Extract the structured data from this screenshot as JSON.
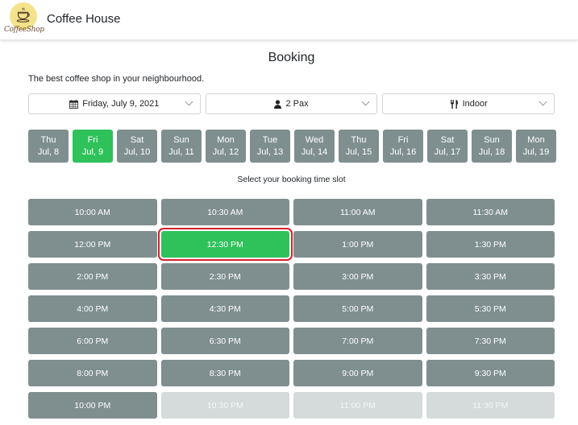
{
  "header": {
    "logo_text": "CoffeeShop",
    "brand": "Coffee House"
  },
  "page": {
    "title": "Booking",
    "tagline": "The best coffee shop in your neighbourhood.",
    "slot_hint": "Select your booking time slot"
  },
  "filters": {
    "date": {
      "icon": "calendar-icon",
      "value": "Friday, July 9, 2021"
    },
    "party": {
      "icon": "person-icon",
      "value": "2 Pax"
    },
    "seating": {
      "icon": "utensils-icon",
      "value": "Indoor"
    }
  },
  "dates": [
    {
      "day": "Thu",
      "date": "Jul, 8",
      "active": false
    },
    {
      "day": "Fri",
      "date": "Jul, 9",
      "active": true
    },
    {
      "day": "Sat",
      "date": "Jul, 10",
      "active": false
    },
    {
      "day": "Sun",
      "date": "Jul, 11",
      "active": false
    },
    {
      "day": "Mon",
      "date": "Jul, 12",
      "active": false
    },
    {
      "day": "Tue",
      "date": "Jul, 13",
      "active": false
    },
    {
      "day": "Wed",
      "date": "Jul, 14",
      "active": false
    },
    {
      "day": "Thu",
      "date": "Jul, 15",
      "active": false
    },
    {
      "day": "Fri",
      "date": "Jul, 16",
      "active": false
    },
    {
      "day": "Sat",
      "date": "Jul, 17",
      "active": false
    },
    {
      "day": "Sun",
      "date": "Jul, 18",
      "active": false
    },
    {
      "day": "Mon",
      "date": "Jul, 19",
      "active": false
    }
  ],
  "slots": [
    {
      "time": "10:00 AM",
      "state": "available"
    },
    {
      "time": "10:30 AM",
      "state": "available"
    },
    {
      "time": "11:00 AM",
      "state": "available"
    },
    {
      "time": "11:30 AM",
      "state": "available"
    },
    {
      "time": "12:00 PM",
      "state": "available"
    },
    {
      "time": "12:30 PM",
      "state": "selected"
    },
    {
      "time": "1:00 PM",
      "state": "available"
    },
    {
      "time": "1:30 PM",
      "state": "available"
    },
    {
      "time": "2:00 PM",
      "state": "available"
    },
    {
      "time": "2:30 PM",
      "state": "available"
    },
    {
      "time": "3:00 PM",
      "state": "available"
    },
    {
      "time": "3:30 PM",
      "state": "available"
    },
    {
      "time": "4:00 PM",
      "state": "available"
    },
    {
      "time": "4:30 PM",
      "state": "available"
    },
    {
      "time": "5:00 PM",
      "state": "available"
    },
    {
      "time": "5:30 PM",
      "state": "available"
    },
    {
      "time": "6:00 PM",
      "state": "available"
    },
    {
      "time": "6:30 PM",
      "state": "available"
    },
    {
      "time": "7:00 PM",
      "state": "available"
    },
    {
      "time": "7:30 PM",
      "state": "available"
    },
    {
      "time": "8:00 PM",
      "state": "available"
    },
    {
      "time": "8:30 PM",
      "state": "available"
    },
    {
      "time": "9:00 PM",
      "state": "available"
    },
    {
      "time": "9:30 PM",
      "state": "available"
    },
    {
      "time": "10:00 PM",
      "state": "available"
    },
    {
      "time": "10:30 PM",
      "state": "disabled"
    },
    {
      "time": "11:00 PM",
      "state": "disabled"
    },
    {
      "time": "11:30 PM",
      "state": "disabled"
    }
  ],
  "colors": {
    "available": "#7f8f8f",
    "selected": "#2fc25b",
    "disabled": "#d4dbda",
    "selection_outline": "#d6202c"
  }
}
